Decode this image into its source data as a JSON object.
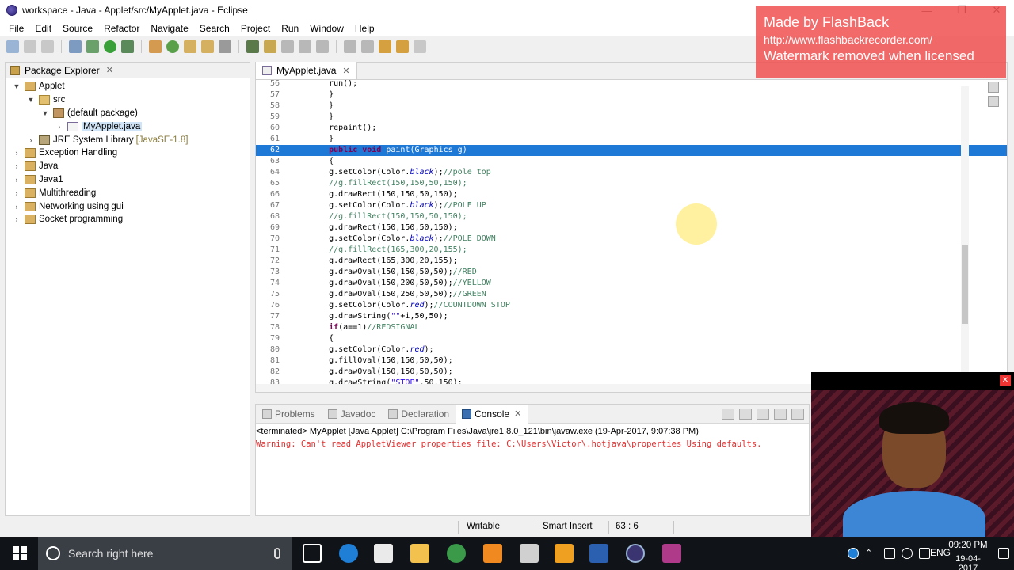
{
  "window": {
    "title": "workspace - Java - Applet/src/MyApplet.java - Eclipse"
  },
  "menu": [
    "File",
    "Edit",
    "Source",
    "Refactor",
    "Navigate",
    "Search",
    "Project",
    "Run",
    "Window",
    "Help"
  ],
  "watermark": {
    "line1": "Made by FlashBack",
    "line2": "http://www.flashbackrecorder.com/",
    "line3": "Watermark removed when licensed"
  },
  "package_explorer": {
    "title": "Package Explorer",
    "items": [
      {
        "arrow": "▼",
        "label": "Applet",
        "icon": "project-icon",
        "indent": 0
      },
      {
        "arrow": "▼",
        "label": "src",
        "icon": "source-folder-icon",
        "indent": 1
      },
      {
        "arrow": "▼",
        "label": "(default package)",
        "icon": "package-icon",
        "indent": 2
      },
      {
        "arrow": "›",
        "label": "MyApplet.java",
        "icon": "java-file-icon",
        "indent": 3,
        "selected": true
      },
      {
        "arrow": "›",
        "label": "JRE System Library",
        "meta": "[JavaSE-1.8]",
        "icon": "library-icon",
        "indent": 1
      },
      {
        "arrow": "›",
        "label": "Exception Handling",
        "icon": "project-icon",
        "indent": 0
      },
      {
        "arrow": "›",
        "label": "Java",
        "icon": "project-icon",
        "indent": 0
      },
      {
        "arrow": "›",
        "label": "Java1",
        "icon": "project-icon",
        "indent": 0
      },
      {
        "arrow": "›",
        "label": "Multithreading",
        "icon": "project-icon",
        "indent": 0
      },
      {
        "arrow": "›",
        "label": "Networking using gui",
        "icon": "project-icon",
        "indent": 0
      },
      {
        "arrow": "›",
        "label": "Socket programming",
        "icon": "project-icon",
        "indent": 0
      }
    ]
  },
  "editor": {
    "tab": "MyApplet.java",
    "lines": [
      {
        "n": "56",
        "html": "    run();"
      },
      {
        "n": "57",
        "html": "    }"
      },
      {
        "n": "58",
        "html": "    }"
      },
      {
        "n": "59",
        "html": "    }"
      },
      {
        "n": "60",
        "html": "    repaint();"
      },
      {
        "n": "61",
        "html": "    }"
      },
      {
        "n": "62",
        "html": "    public void paint(Graphics g)",
        "hl": true
      },
      {
        "n": "63",
        "html": "    {"
      },
      {
        "n": "64",
        "html": "    g.setColor(Color.black);//pole top"
      },
      {
        "n": "65",
        "html": "    //g.fillRect(150,150,50,150);"
      },
      {
        "n": "66",
        "html": "    g.drawRect(150,150,50,150);"
      },
      {
        "n": "67",
        "html": "    g.setColor(Color.black);//POLE UP"
      },
      {
        "n": "68",
        "html": "    //g.fillRect(150,150,50,150);"
      },
      {
        "n": "69",
        "html": "    g.drawRect(150,150,50,150);"
      },
      {
        "n": "70",
        "html": "    g.setColor(Color.black);//POLE DOWN"
      },
      {
        "n": "71",
        "html": "    //g.fillRect(165,300,20,155);"
      },
      {
        "n": "72",
        "html": "    g.drawRect(165,300,20,155);"
      },
      {
        "n": "73",
        "html": "    g.drawOval(150,150,50,50);//RED"
      },
      {
        "n": "74",
        "html": "    g.drawOval(150,200,50,50);//YELLOW"
      },
      {
        "n": "75",
        "html": "    g.drawOval(150,250,50,50);//GREEN"
      },
      {
        "n": "76",
        "html": "    g.setColor(Color.red);//COUNTDOWN STOP"
      },
      {
        "n": "77",
        "html": "    g.drawString(\"\"+i,50,50);"
      },
      {
        "n": "78",
        "html": "    if(a==1)//REDSIGNAL"
      },
      {
        "n": "79",
        "html": "    {"
      },
      {
        "n": "80",
        "html": "    g.setColor(Color.red);"
      },
      {
        "n": "81",
        "html": "    g.fillOval(150,150,50,50);"
      },
      {
        "n": "82",
        "html": "    g.drawOval(150,150,50,50);"
      },
      {
        "n": "83",
        "html": "    g.drawString(\"STOP\",50,150);"
      }
    ]
  },
  "console": {
    "tabs": [
      "Problems",
      "Javadoc",
      "Declaration",
      "Console"
    ],
    "active_tab": "Console",
    "status": "<terminated> MyApplet [Java Applet] C:\\Program Files\\Java\\jre1.8.0_121\\bin\\javaw.exe (19-Apr-2017, 9:07:38 PM)",
    "warning": "Warning: Can't read AppletViewer properties file: C:\\Users\\Victor\\.hotjava\\properties Using defaults."
  },
  "statusbar": {
    "mode": "Writable",
    "insert": "Smart Insert",
    "position": "63 : 6"
  },
  "taskbar": {
    "search_placeholder": "Search right here",
    "lang": "ENG",
    "time": "09:20 PM",
    "date": "19-04-2017"
  },
  "colors": {
    "selection": "#1e78d6",
    "keyword": "#7f0055",
    "comment": "#3f7f5f",
    "warning": "#e03030",
    "watermark": "#f05050"
  }
}
